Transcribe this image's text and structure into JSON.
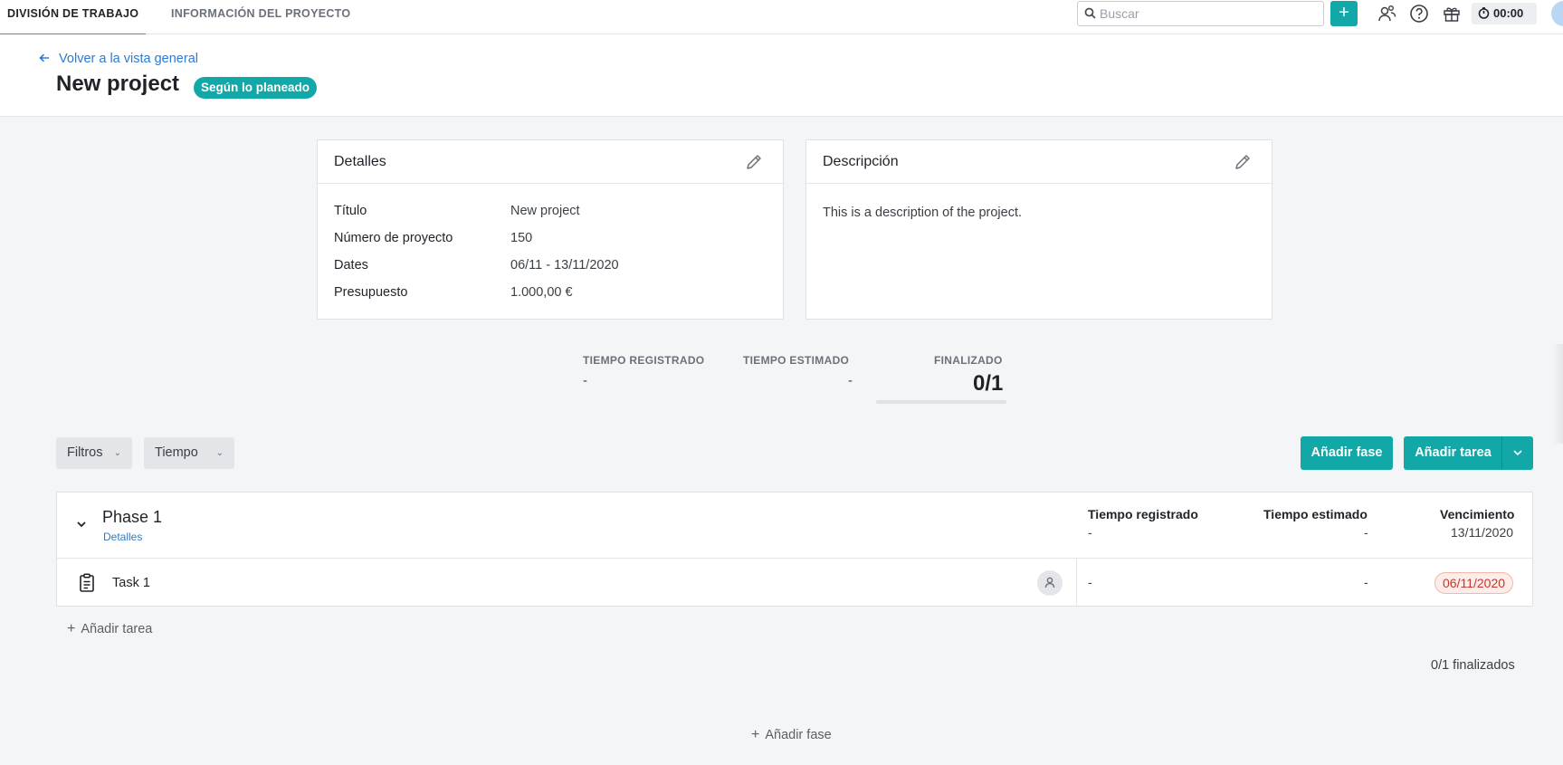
{
  "nav": {
    "tabs": [
      {
        "label": "DIVISIÓN DE TRABAJO",
        "active": true
      },
      {
        "label": "INFORMACIÓN DEL PROYECTO",
        "active": false
      }
    ],
    "search_placeholder": "Buscar",
    "add_label": "+",
    "timer": "00:00",
    "icons": [
      "search-icon",
      "people-icon",
      "help-icon",
      "gift-icon",
      "stopwatch-icon"
    ]
  },
  "header": {
    "back_label": "Volver a la vista general",
    "title": "New project",
    "status": "Según lo planeado"
  },
  "details": {
    "title": "Detalles",
    "rows": [
      {
        "label": "Título",
        "value": "New project"
      },
      {
        "label": "Número de proyecto",
        "value": "150"
      },
      {
        "label": "Dates",
        "value": "06/11 - 13/11/2020"
      },
      {
        "label": "Presupuesto",
        "value": "1.000,00 €"
      }
    ]
  },
  "description": {
    "title": "Descripción",
    "text": "This is a description of the project."
  },
  "stats": {
    "registered_label": "TIEMPO REGISTRADO",
    "registered_value": "-",
    "estimated_label": "TIEMPO ESTIMADO",
    "estimated_value": "-",
    "finished_label": "FINALIZADO",
    "finished_value": "0/1",
    "finished_progress": 0
  },
  "toolbar": {
    "filters": "Filtros",
    "time": "Tiempo",
    "add_phase": "Añadir fase",
    "add_task": "Añadir tarea"
  },
  "phase": {
    "name": "Phase 1",
    "details_link": "Detalles",
    "col_registered": "Tiempo registrado",
    "col_estimated": "Tiempo estimado",
    "col_due": "Vencimiento",
    "registered": "-",
    "estimated": "-",
    "due": "13/11/2020",
    "tasks": [
      {
        "name": "Task 1",
        "registered": "-",
        "estimated": "-",
        "due": "06/11/2020"
      }
    ]
  },
  "footer": {
    "add_task": "Añadir tarea",
    "finished_count": "0/1 finalizados",
    "add_phase": "Añadir fase"
  },
  "colors": {
    "accent": "#12a8a8",
    "link": "#2a7bd6",
    "overdue": "#c0392b"
  }
}
